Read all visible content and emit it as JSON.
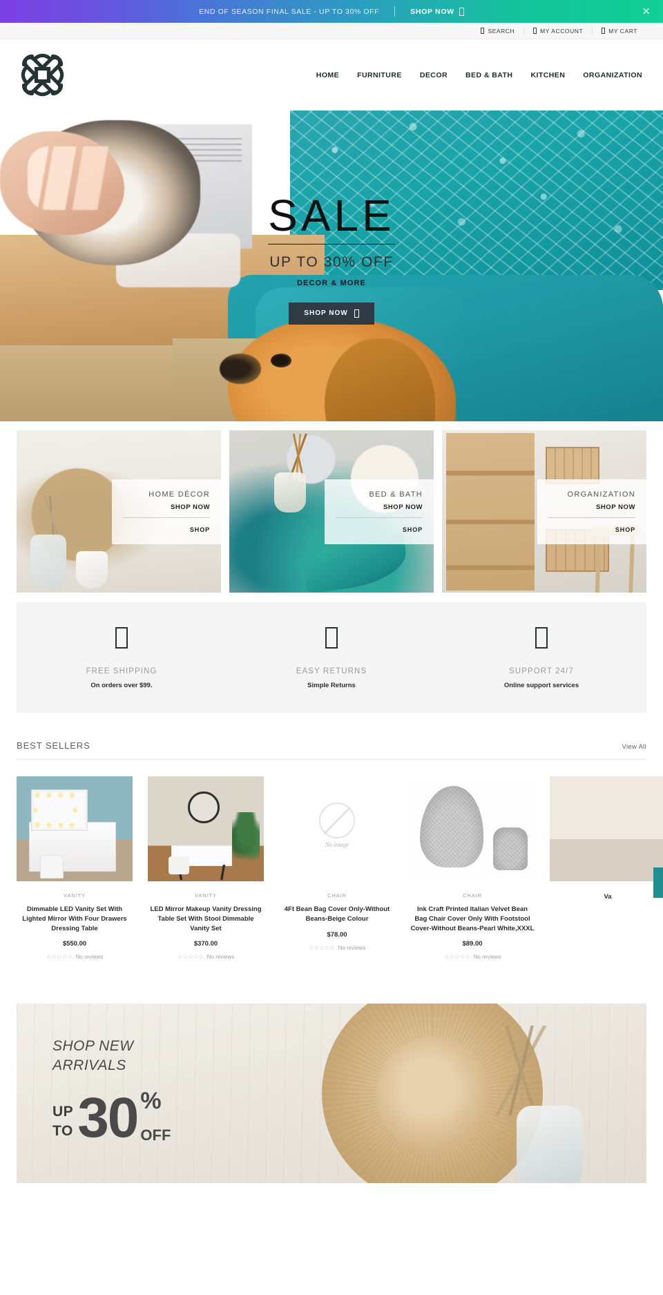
{
  "announcement": {
    "text": "END OF SEASON FINAL SALE - UP TO 30% OFF",
    "cta_label": "SHOP NOW",
    "close_label": "✕",
    "gradient_start": "#7b3fe4",
    "gradient_end": "#11cf95"
  },
  "utility": {
    "items": [
      {
        "label": "SEARCH",
        "icon": "search-icon"
      },
      {
        "label": "MY ACCOUNT",
        "icon": "user-icon"
      },
      {
        "label": "MY CART",
        "icon": "cart-icon"
      }
    ]
  },
  "header": {
    "logo_name": "celtic-knot-logo",
    "nav": [
      {
        "label": "HOME"
      },
      {
        "label": "FURNITURE"
      },
      {
        "label": "DECOR"
      },
      {
        "label": "BED & BATH"
      },
      {
        "label": "KITCHEN"
      },
      {
        "label": "ORGANIZATION"
      }
    ]
  },
  "hero": {
    "headline": "SALE",
    "subhead": "UP TO 30% OFF",
    "tagline": "DECOR & MORE",
    "button_label": "SHOP NOW",
    "button_color": "#2f3b44"
  },
  "categories": [
    {
      "title": "HOME DÉCOR",
      "subtitle": "SHOP NOW",
      "link": "SHOP"
    },
    {
      "title": "BED & BATH",
      "subtitle": "SHOP NOW",
      "link": "SHOP"
    },
    {
      "title": "ORGANIZATION",
      "subtitle": "SHOP NOW",
      "link": "SHOP"
    }
  ],
  "services": [
    {
      "title": "FREE SHIPPING",
      "desc": "On orders over $99.",
      "icon": "truck-icon"
    },
    {
      "title": "EASY RETURNS",
      "desc": "Simple Returns",
      "icon": "return-icon"
    },
    {
      "title": "SUPPORT 24/7",
      "desc": "Online support services",
      "icon": "headset-icon"
    }
  ],
  "best_sellers": {
    "title": "BEST SELLERS",
    "view_all": "View All",
    "products": [
      {
        "category": "VANITY",
        "name": "Dimmable LED Vanity Set With Lighted Mirror With Four Drawers Dressing Table",
        "price": "$550.00",
        "stars": "☆☆☆☆☆",
        "reviews": "No reviews"
      },
      {
        "category": "VANITY",
        "name": "LED Mirror Makeup Vanity Dressing Table Set With Stool Dimmable Vanity Set",
        "price": "$370.00",
        "stars": "☆☆☆☆☆",
        "reviews": "No reviews"
      },
      {
        "category": "CHAIR",
        "name": "4Ft Bean Bag Cover Only-Without Beans-Beige Colour",
        "price": "$78.00",
        "stars": "☆☆☆☆☆",
        "reviews": "No reviews",
        "no_image_label": "No image"
      },
      {
        "category": "CHAIR",
        "name": "Ink Craft Printed Italian Velvet Bean Bag Chair Cover Only With Footstool Cover-Without Beans-Pearl White,XXXL",
        "price": "$89.00",
        "stars": "☆☆☆☆☆",
        "reviews": "No reviews"
      },
      {
        "category": "",
        "name": "Va",
        "price": "",
        "stars": "",
        "reviews": ""
      }
    ]
  },
  "arrivals": {
    "title": "SHOP NEW\nARRIVALS",
    "up": "UP",
    "to": "TO",
    "number": "30",
    "percent": "%",
    "off": "OFF"
  }
}
